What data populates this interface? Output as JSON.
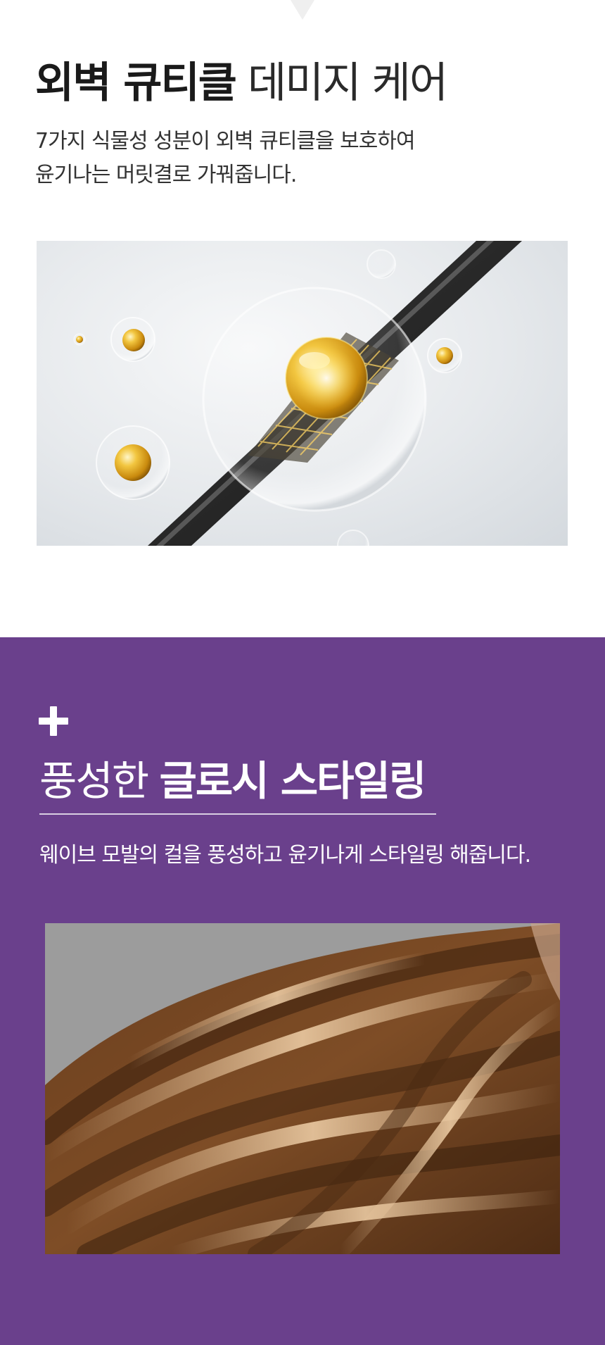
{
  "section1": {
    "title_bold": "외벽 큐티클",
    "title_light": " 데미지 케어",
    "description_lines": [
      "7가지 식물성 성분이 외벽 큐티클을 보호하여",
      "윤기나는 머릿결로 가꿔줍니다."
    ],
    "image_icon": "hair-strand-oil-capsule-illustration"
  },
  "section2": {
    "plus_icon": "plus-icon",
    "title_light": "풍성한 ",
    "title_bold": "글로시 스타일링",
    "description": "웨이브 모발의 컬을 풍성하고 윤기나게 스타일링 해줍니다.",
    "image_icon": "glossy-wavy-brown-hair-photo"
  },
  "colors": {
    "background": "#ffffff",
    "accent_purple": "#6a408c",
    "title_text": "#1a1a1a",
    "body_text": "#333333",
    "oil_gold": "#e0a81a",
    "hair_brown": "#7a4a24"
  }
}
